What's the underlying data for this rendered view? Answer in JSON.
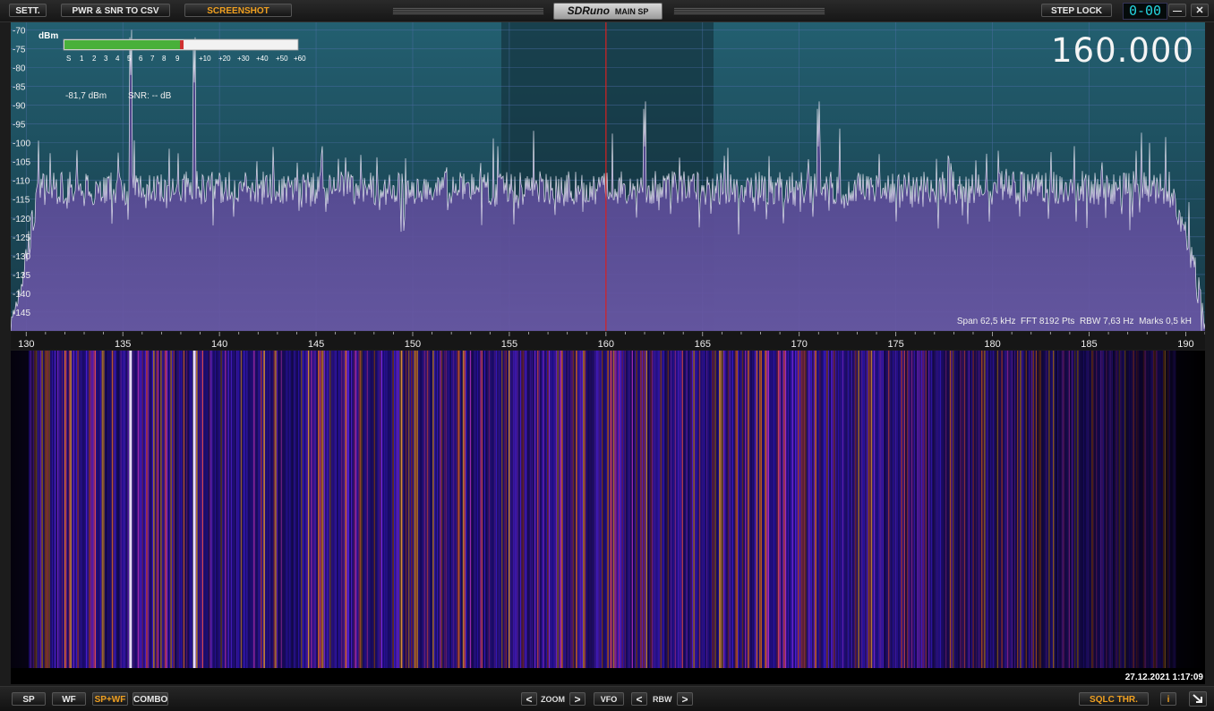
{
  "topbar": {
    "settings_label": "SETT.",
    "csv_label": "PWR & SNR TO CSV",
    "screenshot_label": "SCREENSHOT",
    "brand": "SDRuno",
    "window_name": "MAIN SP",
    "step_lock_label": "STEP LOCK",
    "step_digits": "0-00",
    "minimize_label": "—",
    "close_label": "✕"
  },
  "spectrum": {
    "dbm_label": "dBm",
    "level_readout": "-81,7 dBm",
    "snr_readout": "SNR: -- dB",
    "center_frequency": "160.000",
    "info": "Span 62,5 kHz  FFT 8192 Pts  RBW 7,63 Hz  Marks 0,5 kH",
    "s_meter_labels": [
      "S",
      "1",
      "2",
      "3",
      "4",
      "5",
      "6",
      "7",
      "8",
      "9",
      "+10",
      "+20",
      "+30",
      "+40",
      "+50",
      "+60"
    ],
    "s_meter_level": 0.42,
    "db_ticks": [
      -70,
      -75,
      -80,
      -85,
      -90,
      -95,
      -100,
      -105,
      -110,
      -115,
      -120,
      -125,
      -130,
      -135,
      -140,
      -145
    ],
    "db_range": [
      -150,
      -68
    ],
    "freq_ticks": [
      130,
      135,
      140,
      145,
      150,
      155,
      160,
      165,
      170,
      175,
      180,
      185,
      190
    ],
    "freq_range": [
      129.2,
      191.0
    ],
    "vfo_frequency": 160.0,
    "peaks": [
      {
        "f": 135.4,
        "db": -82
      },
      {
        "f": 138.7,
        "db": -84
      },
      {
        "f": 162.0,
        "db": -101
      },
      {
        "f": 171.0,
        "db": -101
      }
    ],
    "colors": {
      "background": "#1f5566",
      "filter_band": "#153845",
      "fill": "#5e4a98",
      "trace": "#e4e4ee",
      "vfo_line": "#d82020"
    }
  },
  "waterfall": {
    "timestamp": "27.12.2021 1:17:09"
  },
  "bottombar": {
    "sp_label": "SP",
    "wf_label": "WF",
    "spwf_label": "SP+WF",
    "combo_label": "COMBO",
    "zoom_label": "ZOOM",
    "vfo_label": "VFO",
    "rbw_label": "RBW",
    "sqlc_label": "SQLC THR.",
    "info_label": "i",
    "prev_label": "<",
    "next_label": ">"
  }
}
